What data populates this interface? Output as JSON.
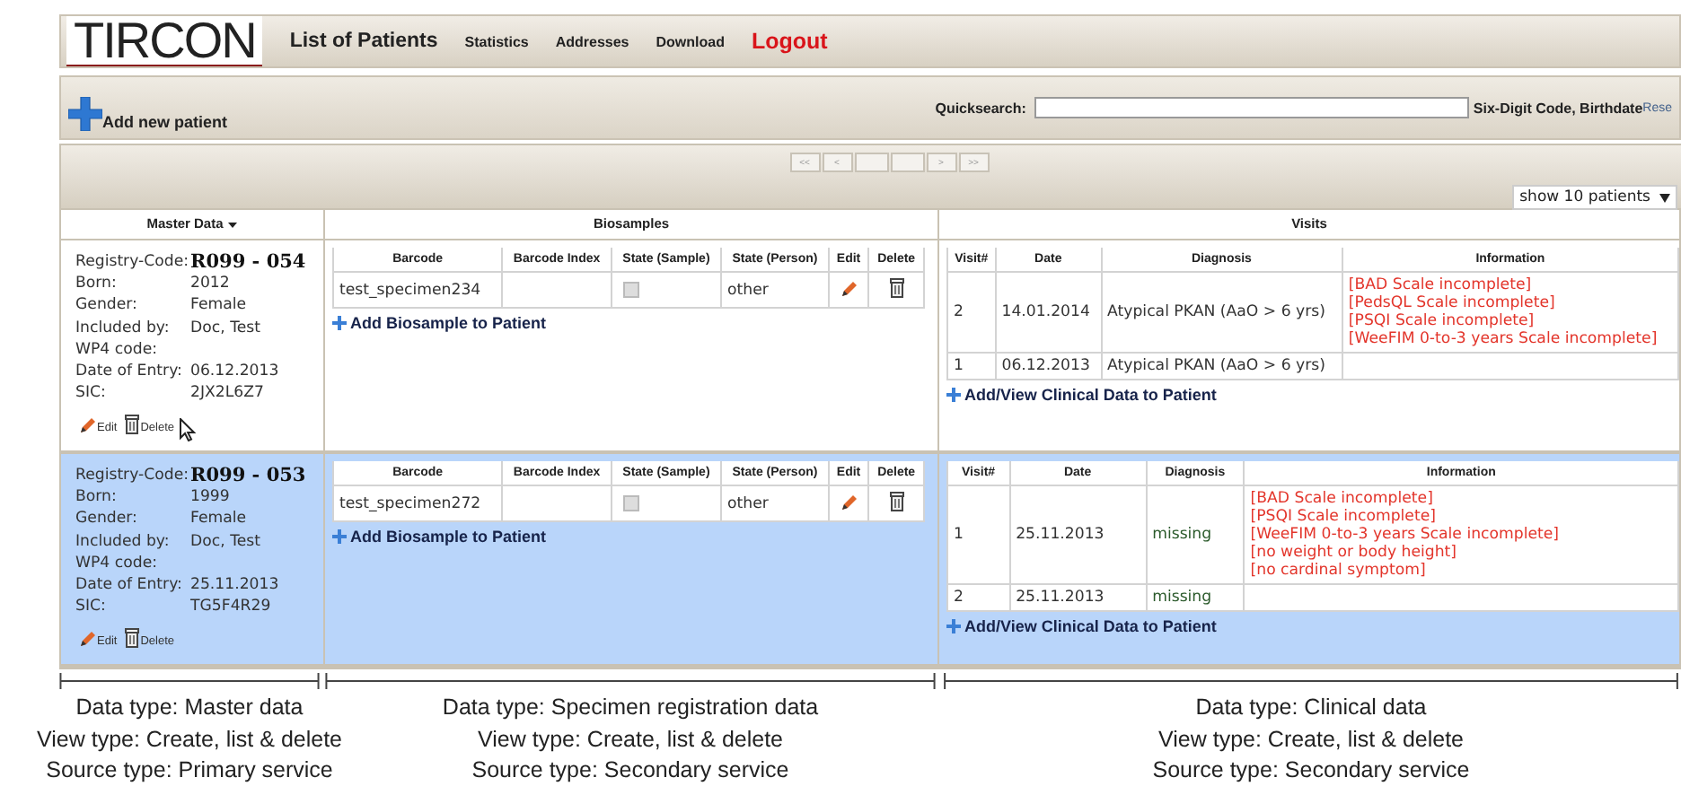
{
  "header": {
    "logo": "TIRCON",
    "nav": [
      {
        "label": "List of Patients",
        "kind": "current"
      },
      {
        "label": "Statistics",
        "kind": "link"
      },
      {
        "label": "Addresses",
        "kind": "link"
      },
      {
        "label": "Download",
        "kind": "link"
      },
      {
        "label": "Logout",
        "kind": "logout"
      }
    ]
  },
  "toolbar": {
    "add_button": "Add new patient",
    "quicksearch_label": "Quicksearch:",
    "quicksearch_hint": "Six-Digit Code, Birthdate",
    "reset_link": "Rese"
  },
  "pager": {
    "first": "<<",
    "prev": "<",
    "next": ">",
    "last": ">>"
  },
  "page_size": "show 10 patients",
  "columns": [
    "Master Data",
    "Biosamples",
    "Visits"
  ],
  "patients": [
    {
      "selected": false,
      "registry_label": "Registry-Code:",
      "registry_code": "R099 - 054",
      "fields": [
        {
          "label": "Born:",
          "value": "2012"
        },
        {
          "label": "Gender:",
          "value": "Female"
        },
        {
          "label": "Included by:",
          "value": "Doc, Test"
        },
        {
          "label": "WP4 code:"
        },
        {
          "label": "Date of Entry:",
          "value": "06.12.2013"
        },
        {
          "label": "SIC:",
          "value": "2JX2L6Z7"
        }
      ],
      "edit": "Edit",
      "delete": "Delete",
      "cursor": true,
      "biosamples": {
        "columns": [
          "Barcode",
          "Barcode Index",
          "State (Sample)",
          "State (Person)",
          "Edit",
          "Delete"
        ],
        "rows": [
          {
            "barcode": "test_specimen234",
            "state_sample_checked": false,
            "state_person": "other"
          }
        ],
        "add": "Add Biosample to Patient"
      },
      "visits": {
        "columns": [
          "Visit#",
          "Date",
          "Diagnosis",
          "Information"
        ],
        "rows": [
          {
            "visit": "2",
            "date": "14.01.2014",
            "diagnosis": "Atypical PKAN (AaO > 6 yrs)",
            "information": [
              "[BAD Scale incomplete]",
              "[PedsQL Scale incomplete]",
              "[PSQI Scale incomplete]",
              "[WeeFIM 0-to-3 years Scale incomplete]"
            ]
          },
          {
            "visit": "1",
            "date": "06.12.2013",
            "diagnosis": "Atypical PKAN (AaO > 6 yrs)"
          }
        ],
        "add": "Add/View Clinical Data to Patient"
      }
    },
    {
      "selected": true,
      "registry_label": "Registry-Code:",
      "registry_code": "R099 - 053",
      "fields": [
        {
          "label": "Born:",
          "value": "1999"
        },
        {
          "label": "Gender:",
          "value": "Female"
        },
        {
          "label": "Included by:",
          "value": "Doc, Test"
        },
        {
          "label": "WP4 code:"
        },
        {
          "label": "Date of Entry:",
          "value": "25.11.2013"
        },
        {
          "label": "SIC:",
          "value": "TG5F4R29"
        }
      ],
      "edit": "Edit",
      "delete": "Delete",
      "cursor": false,
      "biosamples": {
        "columns": [
          "Barcode",
          "Barcode Index",
          "State (Sample)",
          "State (Person)",
          "Edit",
          "Delete"
        ],
        "rows": [
          {
            "barcode": "test_specimen272",
            "state_sample_checked": false,
            "state_person": "other"
          }
        ],
        "add": "Add Biosample to Patient"
      },
      "visits": {
        "columns": [
          "Visit#",
          "Date",
          "Diagnosis",
          "Information"
        ],
        "rows": [
          {
            "visit": "1",
            "date": "25.11.2013",
            "diagnosis": "missing",
            "information": [
              "[BAD Scale incomplete]",
              "[PSQI Scale incomplete]",
              "[WeeFIM 0-to-3 years Scale incomplete]",
              "[no weight or body height]",
              "[no cardinal symptom]"
            ]
          },
          {
            "visit": "2",
            "date": "25.11.2013",
            "diagnosis": "missing"
          }
        ],
        "add": "Add/View Clinical Data to Patient"
      }
    }
  ],
  "annotations": [
    {
      "lines": [
        "Data type: Master data",
        "View type: Create, list & delete",
        "Source type: Primary service"
      ]
    },
    {
      "lines": [
        "Data type: Specimen registration data",
        "View type: Create, list & delete",
        "Source type: Secondary service"
      ]
    },
    {
      "lines": [
        "Data type: Clinical data",
        "View type: Create, list & delete",
        "Source type: Secondary service"
      ]
    }
  ]
}
